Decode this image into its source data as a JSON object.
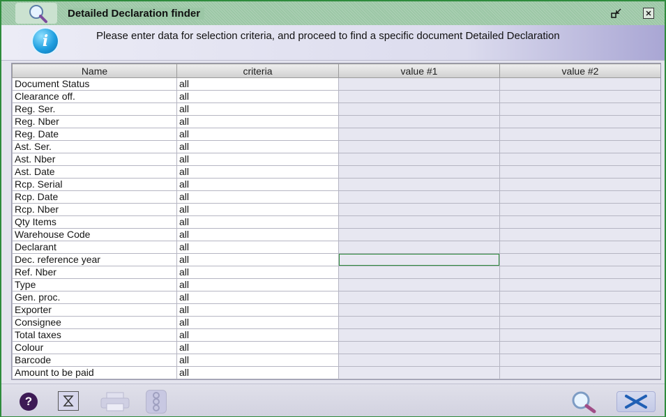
{
  "window": {
    "title": "Detailed Declaration finder",
    "restore_glyph": "▫↙",
    "close_glyph": "✕"
  },
  "info": {
    "text": "Please enter data for selection criteria, and proceed to find a specific document Detailed Declaration",
    "icon": "info-icon"
  },
  "table": {
    "columns": [
      "Name",
      "criteria",
      "value #1",
      "value #2"
    ],
    "rows": [
      {
        "name": "Document Status",
        "criteria": "all",
        "value1": "",
        "value2": ""
      },
      {
        "name": "Clearance off.",
        "criteria": "all",
        "value1": "",
        "value2": ""
      },
      {
        "name": "Reg. Ser.",
        "criteria": "all",
        "value1": "",
        "value2": ""
      },
      {
        "name": "Reg. Nber",
        "criteria": "all",
        "value1": "",
        "value2": ""
      },
      {
        "name": "Reg. Date",
        "criteria": "all",
        "value1": "",
        "value2": ""
      },
      {
        "name": "Ast. Ser.",
        "criteria": "all",
        "value1": "",
        "value2": ""
      },
      {
        "name": "Ast. Nber",
        "criteria": "all",
        "value1": "",
        "value2": ""
      },
      {
        "name": "Ast. Date",
        "criteria": "all",
        "value1": "",
        "value2": ""
      },
      {
        "name": "Rcp. Serial",
        "criteria": "all",
        "value1": "",
        "value2": ""
      },
      {
        "name": "Rcp. Date",
        "criteria": "all",
        "value1": "",
        "value2": ""
      },
      {
        "name": "Rcp. Nber",
        "criteria": "all",
        "value1": "",
        "value2": ""
      },
      {
        "name": "Qty Items",
        "criteria": "all",
        "value1": "",
        "value2": ""
      },
      {
        "name": "Warehouse Code",
        "criteria": "all",
        "value1": "",
        "value2": ""
      },
      {
        "name": "Declarant",
        "criteria": "all",
        "value1": "",
        "value2": ""
      },
      {
        "name": "Dec. reference year",
        "criteria": "all",
        "value1": "",
        "value2": ""
      },
      {
        "name": "Ref. Nber",
        "criteria": "all",
        "value1": "",
        "value2": ""
      },
      {
        "name": "Type",
        "criteria": "all",
        "value1": "",
        "value2": ""
      },
      {
        "name": "Gen. proc.",
        "criteria": "all",
        "value1": "",
        "value2": ""
      },
      {
        "name": "Exporter",
        "criteria": "all",
        "value1": "",
        "value2": ""
      },
      {
        "name": "Consignee",
        "criteria": "all",
        "value1": "",
        "value2": ""
      },
      {
        "name": "Total taxes",
        "criteria": "all",
        "value1": "",
        "value2": ""
      },
      {
        "name": "Colour",
        "criteria": "all",
        "value1": "",
        "value2": ""
      },
      {
        "name": "Barcode",
        "criteria": "all",
        "value1": "",
        "value2": ""
      },
      {
        "name": "Amount to be paid",
        "criteria": "all",
        "value1": "",
        "value2": ""
      }
    ],
    "selected_row": 14,
    "selected_column": "value1"
  },
  "toolbar": {
    "help": "?",
    "clear": "⧖",
    "print": "🖶",
    "traffic": "888",
    "cancel": "✕"
  },
  "colors": {
    "window_border": "#2e8b3c",
    "titlebar": "#9cc7a6",
    "grid_background": "#e7e7f1",
    "info_gradient_end": "#a9a6d4"
  }
}
